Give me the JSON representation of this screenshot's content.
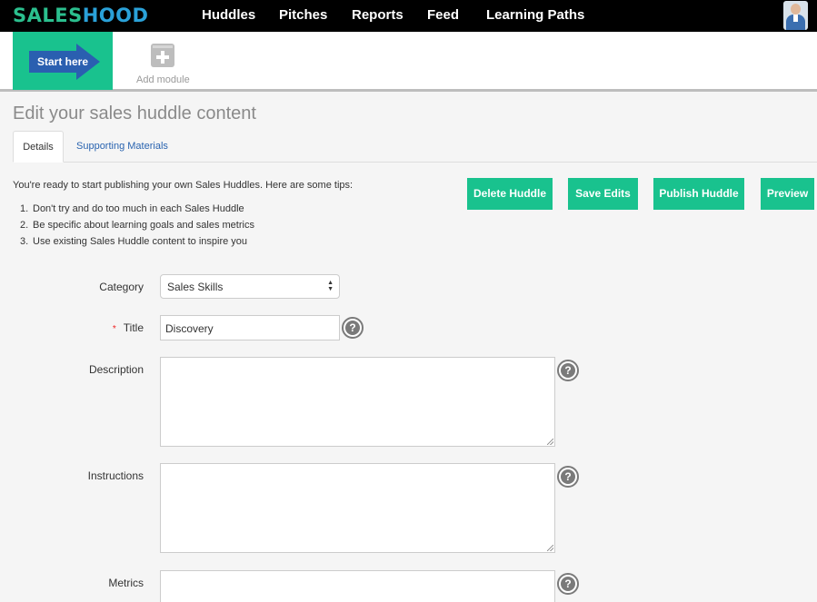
{
  "nav": {
    "logo_part1": "SALES",
    "logo_part2": "HOOD",
    "items": [
      {
        "label": "Huddles"
      },
      {
        "label": "Pitches"
      },
      {
        "label": "Reports"
      },
      {
        "label": "Feed"
      },
      {
        "label": "Learning Paths"
      }
    ]
  },
  "modules": {
    "start_label": "Start here",
    "add_label": "Add module"
  },
  "page": {
    "title": "Edit your sales huddle content"
  },
  "tabs": [
    {
      "label": "Details"
    },
    {
      "label": "Supporting Materials"
    }
  ],
  "intro": {
    "text": "You're ready to start publishing your own Sales Huddles. Here are some tips:",
    "tips": [
      {
        "num": "1.",
        "text": "Don't try and do too much in each Sales Huddle"
      },
      {
        "num": "2.",
        "text": "Be specific about learning goals and sales metrics"
      },
      {
        "num": "3.",
        "text": "Use existing Sales Huddle content to inspire you"
      }
    ]
  },
  "actions": {
    "delete": "Delete Huddle",
    "save": "Save Edits",
    "publish": "Publish Huddle",
    "preview": "Preview"
  },
  "form": {
    "category_label": "Category",
    "category_value": "Sales Skills",
    "required_mark": "*",
    "title_label": "Title",
    "title_value": "Discovery",
    "description_label": "Description",
    "instructions_label": "Instructions",
    "metrics_label": "Metrics",
    "help_glyph": "?"
  },
  "colors": {
    "accent": "#19c28e",
    "nav_bg": "#000000",
    "link": "#2a64b0",
    "logo_sales": "#2bbf8e",
    "logo_hood": "#2aa1d8"
  },
  "icons": {
    "start": "arrow-right-icon",
    "add": "plus-box-icon",
    "help": "question-circle-icon",
    "avatar": "user-avatar"
  }
}
